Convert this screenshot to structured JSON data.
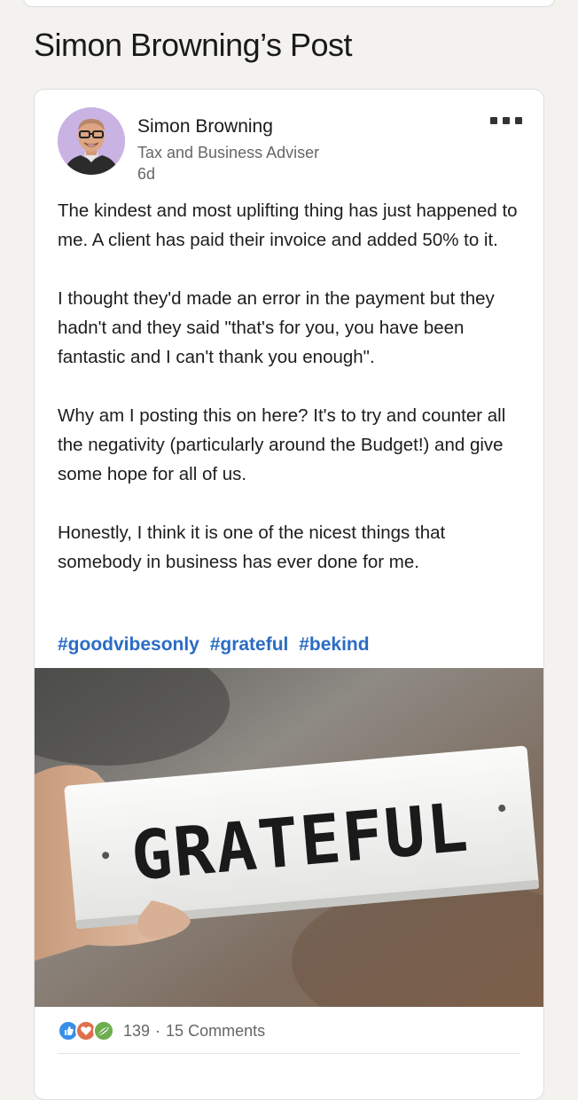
{
  "page": {
    "title": "Simon Browning’s Post"
  },
  "post": {
    "author": {
      "name": "Simon Browning",
      "headline": "Tax and Business Adviser",
      "age": "6d",
      "more_icon": "more-dots-icon"
    },
    "paragraphs": [
      "The kindest and most uplifting thing has just happened to me.  A client has paid their invoice and added 50% to it.",
      "I thought they'd made an error in the payment but they hadn't and they said \"that's for you, you have been fantastic and I can't thank you enough\".",
      "Why am I posting this on here?  It's to try and counter all the negativity (particularly around the Budget!) and give some hope for all of us.",
      "Honestly, I think it is one of the nicest things that somebody in business has ever done for me."
    ],
    "hashtags": [
      "#goodvibesonly",
      "#grateful",
      "#bekind"
    ],
    "image": {
      "sign_text": "GRATEFUL"
    },
    "social": {
      "reaction_icons": [
        "like-icon",
        "love-icon",
        "support-icon"
      ],
      "reactions_count": "139",
      "separator": "·",
      "comments": "15 Comments"
    }
  },
  "colors": {
    "hashtag": "#2b6cc4",
    "secondary_text": "#666666",
    "like": "#378fe9",
    "love": "#df704d",
    "support": "#6dae4f"
  }
}
